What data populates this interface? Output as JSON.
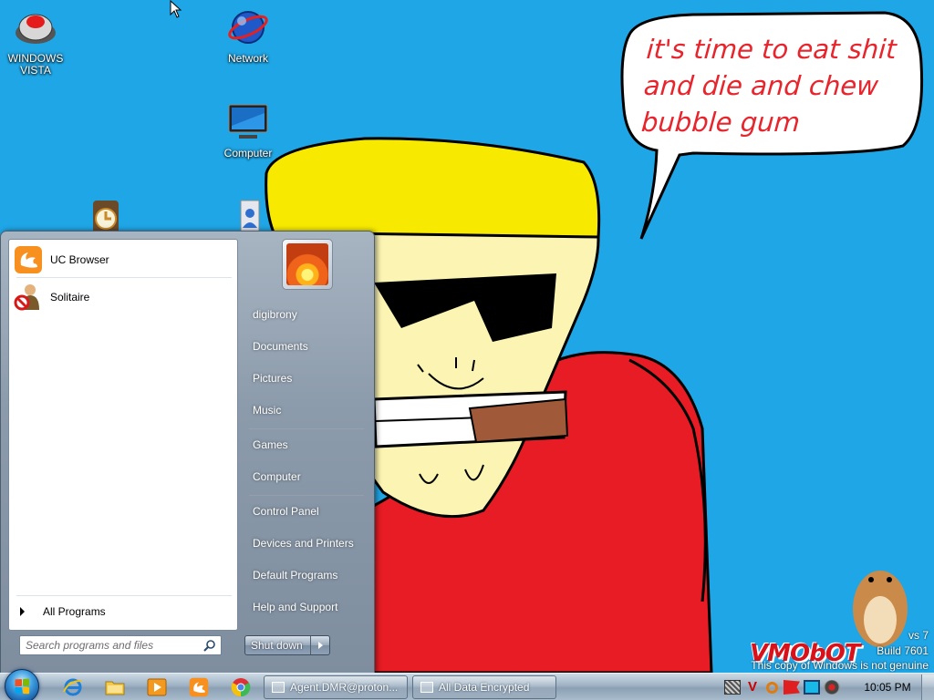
{
  "wallpaper": {
    "speech_bubble": "it's time to eat shit and die and chew bubble gum",
    "logo": "VMObOT"
  },
  "desktop_icons": [
    {
      "id": "windows-vista",
      "label": "WINDOWS VISTA",
      "icon": "dome-icon"
    },
    {
      "id": "network",
      "label": "Network",
      "icon": "globe-icon"
    },
    {
      "id": "computer",
      "label": "Computer",
      "icon": "monitor-icon"
    }
  ],
  "watermark": {
    "line1": "vs 7",
    "line2": "Build 7601",
    "line3": "This copy of Windows is not genuine"
  },
  "start_menu": {
    "pinned": [
      {
        "label": "UC Browser",
        "icon": "uc-browser-icon"
      },
      {
        "label": "Solitaire",
        "icon": "solitaire-icon"
      }
    ],
    "all_programs": "All Programs",
    "search_placeholder": "Search programs and files",
    "right_items": [
      {
        "id": "digibrony",
        "label": "digibrony"
      },
      {
        "id": "documents",
        "label": "Documents"
      },
      {
        "id": "pictures",
        "label": "Pictures"
      },
      {
        "id": "music",
        "label": "Music"
      },
      {
        "id": "games",
        "label": "Games"
      },
      {
        "id": "computer",
        "label": "Computer"
      },
      {
        "id": "control-panel",
        "label": "Control Panel"
      },
      {
        "id": "devices-printers",
        "label": "Devices and Printers"
      },
      {
        "id": "default-programs",
        "label": "Default Programs"
      },
      {
        "id": "help-support",
        "label": "Help and Support"
      }
    ],
    "shutdown_label": "Shut down"
  },
  "taskbar": {
    "pinned": [
      "ie-icon",
      "explorer-icon",
      "media-player-icon",
      "uc-browser-icon",
      "chrome-icon"
    ],
    "windows": [
      {
        "label": "Agent.DMR@proton...",
        "icon": "window-icon"
      },
      {
        "label": "All Data Encrypted",
        "icon": "window-icon"
      }
    ],
    "clock": "10:05 PM"
  },
  "colors": {
    "desktop_bg": "#1fa6e6",
    "bubble_text": "#e8242c",
    "shirt_red": "#e81c24",
    "hat_yellow": "#f7ea00"
  }
}
